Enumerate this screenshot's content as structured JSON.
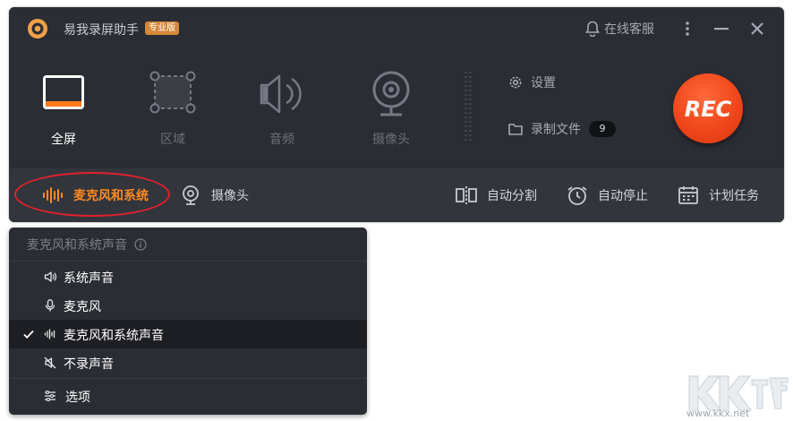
{
  "app": {
    "title": "易我录屏助手",
    "badge": "专业版",
    "support_label": "在线客服"
  },
  "modes": [
    {
      "label": "全屏",
      "icon": "fullscreen-icon",
      "active": true
    },
    {
      "label": "区域",
      "icon": "region-icon",
      "active": false
    },
    {
      "label": "音频",
      "icon": "audio-icon",
      "active": false
    },
    {
      "label": "摄像头",
      "icon": "webcam-icon",
      "active": false
    }
  ],
  "side": {
    "settings_label": "设置",
    "files_label": "录制文件",
    "files_count": "9"
  },
  "rec_label": "REC",
  "bottom": {
    "audio_source_label": "麦克风和系统",
    "camera_label": "摄像头",
    "auto_split_label": "自动分割",
    "auto_stop_label": "自动停止",
    "schedule_label": "计划任务"
  },
  "dropdown": {
    "header": "麦克风和系统声音",
    "items": [
      {
        "label": "系统声音",
        "icon": "speaker-icon",
        "selected": false
      },
      {
        "label": "麦克风",
        "icon": "microphone-icon",
        "selected": false
      },
      {
        "label": "麦克风和系统声音",
        "icon": "waveform-icon",
        "selected": true
      },
      {
        "label": "不录声音",
        "icon": "mute-icon",
        "selected": false
      }
    ],
    "options_label": "选项"
  },
  "watermark": {
    "site": "www.kkx.net"
  },
  "colors": {
    "accent": "#ff8a1e",
    "rec": "#f0461c",
    "window_bg": "#2b2d34",
    "highlight_ring": "#e0212a"
  }
}
